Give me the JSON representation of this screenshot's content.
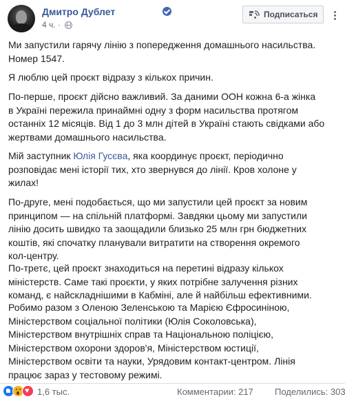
{
  "header": {
    "author_name": "Дмитро Дублет",
    "time": "4 ч.",
    "meta_separator": "·",
    "subscribe_label": "Подписаться"
  },
  "post": {
    "paragraphs": [
      [
        "Ми запустили гарячу лінію з попередження домашнього насильства.",
        "Номер 1547."
      ],
      [
        "Я люблю цей проєкт відразу з кількох причин."
      ],
      [
        "По-перше, проєкт дійсно важливий. За даними ООН кожна 6-а жінка",
        "в Україні пережила принаймні одну з форм насильства протягом",
        "останніх 12 місяців. Від 1 до 3 млн дітей в Україні стають свідками або",
        "жертвами домашнього насильства."
      ],
      [
        "Мій заступник ",
        "Юлія Гусєва",
        ", яка координує проєкт, періодично",
        "розповідає мені історії тих, хто звернувся до лінії. Кров холоне у",
        "жилах!"
      ],
      [
        "По-друге, мені подобається, що ми запустили цей проєкт за новим",
        "принципом — на спільній платформі. Завдяки цьому ми запустили",
        "лінію досить швидко та заощадили близько 25 млн грн бюджетних",
        "коштів, які спочатку планували витратити на створення окремого",
        "кол-центру."
      ],
      [
        "По-третє, цей проєкт знаходиться на перетині відразу кількох",
        "міністерств. Саме такі проєкти, у яких потрібне залучення різних",
        "команд, є найскладнішими в Кабміні, але й найбільш ефективними."
      ],
      [
        "Робимо разом з Оленою Зеленською та Марією Єфросиніною,",
        "Міністерством соціальної політики (Юлія Соколовська),",
        "Міністерством внутрішніх справ та Національною поліцією,",
        "Міністерством охорони здоров'я, Міністерством юстиції,",
        "Міністерством освіти та науки, Урядовим контакт-центром. Лінія",
        "працює зараз у тестовому режимі."
      ]
    ]
  },
  "footer": {
    "reactions_count": "1,6 тыс.",
    "comments": "Комментарии: 217",
    "shares": "Поделились: 303"
  },
  "colors": {
    "link": "#385898",
    "text": "#1c1e21",
    "meta": "#606770"
  }
}
